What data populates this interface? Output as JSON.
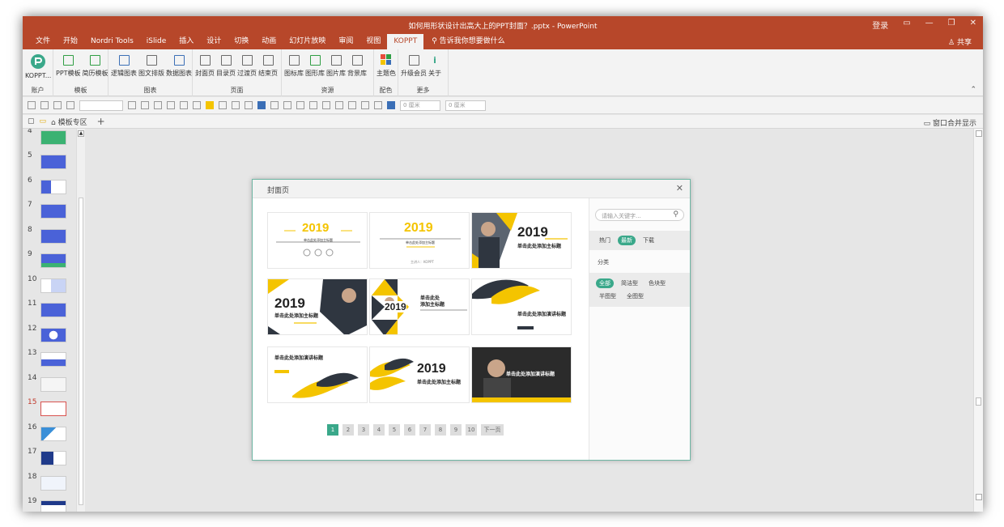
{
  "window": {
    "title": "如何用形状设计出高大上的PPT封面？.pptx  -  PowerPoint",
    "login": "登录",
    "share": "共享",
    "tell_me": "告诉我你想要做什么"
  },
  "tabs": [
    "文件",
    "开始",
    "Nordri Tools",
    "iSlide",
    "插入",
    "设计",
    "切换",
    "动画",
    "幻灯片放映",
    "审阅",
    "视图",
    "KOPPT"
  ],
  "active_tab": "KOPPT",
  "ribbon": {
    "groups": [
      {
        "label": "账户",
        "buttons": [
          "KOPPT..."
        ]
      },
      {
        "label": "模板",
        "buttons": [
          "PPT模板",
          "简历模板"
        ]
      },
      {
        "label": "图表",
        "buttons": [
          "逻辑图表",
          "图文排版",
          "数据图表"
        ]
      },
      {
        "label": "页面",
        "buttons": [
          "封面页",
          "目录页",
          "过渡页",
          "结束页"
        ]
      },
      {
        "label": "资源",
        "buttons": [
          "图标库",
          "图形库",
          "图片库",
          "背景库"
        ]
      },
      {
        "label": "配色",
        "buttons": [
          "主题色"
        ]
      },
      {
        "label": "更多",
        "buttons": [
          "升级会员",
          "关于"
        ]
      }
    ]
  },
  "format_bar": {
    "width_value": "0 厘米",
    "height_value": "0 厘米"
  },
  "tabstrip": {
    "doc_tab": "模板专区",
    "merge_label": "窗口合并显示"
  },
  "slides": [
    {
      "num": "4"
    },
    {
      "num": "5"
    },
    {
      "num": "6"
    },
    {
      "num": "7"
    },
    {
      "num": "8"
    },
    {
      "num": "9"
    },
    {
      "num": "10"
    },
    {
      "num": "11"
    },
    {
      "num": "12"
    },
    {
      "num": "13"
    },
    {
      "num": "14"
    },
    {
      "num": "15"
    },
    {
      "num": "16"
    },
    {
      "num": "17"
    },
    {
      "num": "18"
    },
    {
      "num": "19"
    }
  ],
  "selected_slide": "15",
  "dialog": {
    "title": "封面页",
    "cards": {
      "year": "2019",
      "subtitle": "单击此处添加主标题",
      "subtitle_b": "单击此处添加演讲标题",
      "subtitle_c": "单击此处\n添加主标题",
      "tiny": "主讲人：KOPPT"
    },
    "search_placeholder": "请输入关键字...",
    "sort": {
      "hot": "热门",
      "newest": "最新",
      "download": "下载"
    },
    "category_label": "分类",
    "categories": [
      "全部",
      "简洁型",
      "色块型",
      "半图型",
      "全图型"
    ],
    "pager": [
      "1",
      "2",
      "3",
      "4",
      "5",
      "6",
      "7",
      "8",
      "9",
      "10"
    ],
    "pager_next": "下一页",
    "active_page": "1"
  },
  "colors": {
    "accent": "#b7472a",
    "teal": "#3aa88a",
    "yellow": "#f4c400"
  }
}
